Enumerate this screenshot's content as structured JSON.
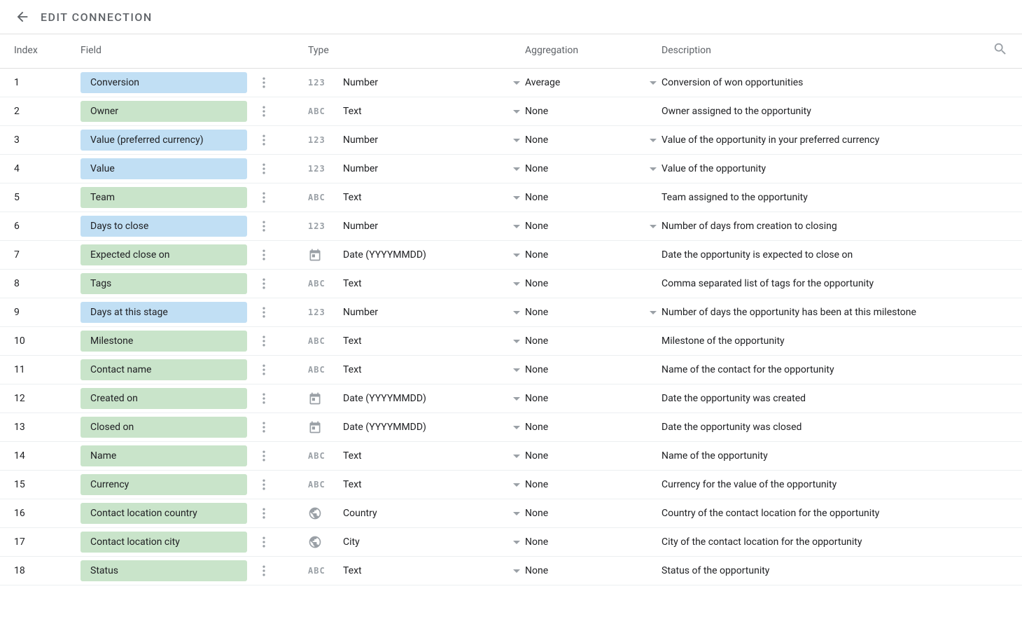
{
  "header": {
    "title": "EDIT CONNECTION"
  },
  "columns": {
    "index": "Index",
    "field": "Field",
    "type": "Type",
    "aggregation": "Aggregation",
    "description": "Description"
  },
  "rows": [
    {
      "index": "1",
      "field": "Conversion",
      "color": "blue",
      "type_icon": "number",
      "type_label": "Number",
      "agg": "Average",
      "agg_dropdown": true,
      "desc": "Conversion of won opportunities"
    },
    {
      "index": "2",
      "field": "Owner",
      "color": "green",
      "type_icon": "text",
      "type_label": "Text",
      "agg": "None",
      "agg_dropdown": false,
      "desc": "Owner assigned to the opportunity"
    },
    {
      "index": "3",
      "field": "Value (preferred currency)",
      "color": "blue",
      "type_icon": "number",
      "type_label": "Number",
      "agg": "None",
      "agg_dropdown": true,
      "desc": "Value of the opportunity in your preferred currency"
    },
    {
      "index": "4",
      "field": "Value",
      "color": "blue",
      "type_icon": "number",
      "type_label": "Number",
      "agg": "None",
      "agg_dropdown": true,
      "desc": "Value of the opportunity"
    },
    {
      "index": "5",
      "field": "Team",
      "color": "green",
      "type_icon": "text",
      "type_label": "Text",
      "agg": "None",
      "agg_dropdown": false,
      "desc": "Team assigned to the opportunity"
    },
    {
      "index": "6",
      "field": "Days to close",
      "color": "blue",
      "type_icon": "number",
      "type_label": "Number",
      "agg": "None",
      "agg_dropdown": true,
      "desc": "Number of days from creation to closing"
    },
    {
      "index": "7",
      "field": "Expected close on",
      "color": "green",
      "type_icon": "date",
      "type_label": "Date (YYYYMMDD)",
      "agg": "None",
      "agg_dropdown": false,
      "desc": "Date the opportunity is expected to close on"
    },
    {
      "index": "8",
      "field": "Tags",
      "color": "green",
      "type_icon": "text",
      "type_label": "Text",
      "agg": "None",
      "agg_dropdown": false,
      "desc": "Comma separated list of tags for the opportunity"
    },
    {
      "index": "9",
      "field": "Days at this stage",
      "color": "blue",
      "type_icon": "number",
      "type_label": "Number",
      "agg": "None",
      "agg_dropdown": true,
      "desc": "Number of days the opportunity has been at this milestone"
    },
    {
      "index": "10",
      "field": "Milestone",
      "color": "green",
      "type_icon": "text",
      "type_label": "Text",
      "agg": "None",
      "agg_dropdown": false,
      "desc": "Milestone of the opportunity"
    },
    {
      "index": "11",
      "field": "Contact name",
      "color": "green",
      "type_icon": "text",
      "type_label": "Text",
      "agg": "None",
      "agg_dropdown": false,
      "desc": "Name of the contact for the opportunity"
    },
    {
      "index": "12",
      "field": "Created on",
      "color": "green",
      "type_icon": "date",
      "type_label": "Date (YYYYMMDD)",
      "agg": "None",
      "agg_dropdown": false,
      "desc": "Date the opportunity was created"
    },
    {
      "index": "13",
      "field": "Closed on",
      "color": "green",
      "type_icon": "date",
      "type_label": "Date (YYYYMMDD)",
      "agg": "None",
      "agg_dropdown": false,
      "desc": "Date the opportunity was closed"
    },
    {
      "index": "14",
      "field": "Name",
      "color": "green",
      "type_icon": "text",
      "type_label": "Text",
      "agg": "None",
      "agg_dropdown": false,
      "desc": "Name of the opportunity"
    },
    {
      "index": "15",
      "field": "Currency",
      "color": "green",
      "type_icon": "text",
      "type_label": "Text",
      "agg": "None",
      "agg_dropdown": false,
      "desc": "Currency for the value of the opportunity"
    },
    {
      "index": "16",
      "field": "Contact location country",
      "color": "green",
      "type_icon": "globe",
      "type_label": "Country",
      "agg": "None",
      "agg_dropdown": false,
      "desc": "Country of the contact location for the opportunity"
    },
    {
      "index": "17",
      "field": "Contact location city",
      "color": "green",
      "type_icon": "globe",
      "type_label": "City",
      "agg": "None",
      "agg_dropdown": false,
      "desc": "City of the contact location for the opportunity"
    },
    {
      "index": "18",
      "field": "Status",
      "color": "green",
      "type_icon": "text",
      "type_label": "Text",
      "agg": "None",
      "agg_dropdown": false,
      "desc": "Status of the opportunity"
    }
  ],
  "type_icon_text": {
    "number": "123",
    "text": "ABC"
  }
}
